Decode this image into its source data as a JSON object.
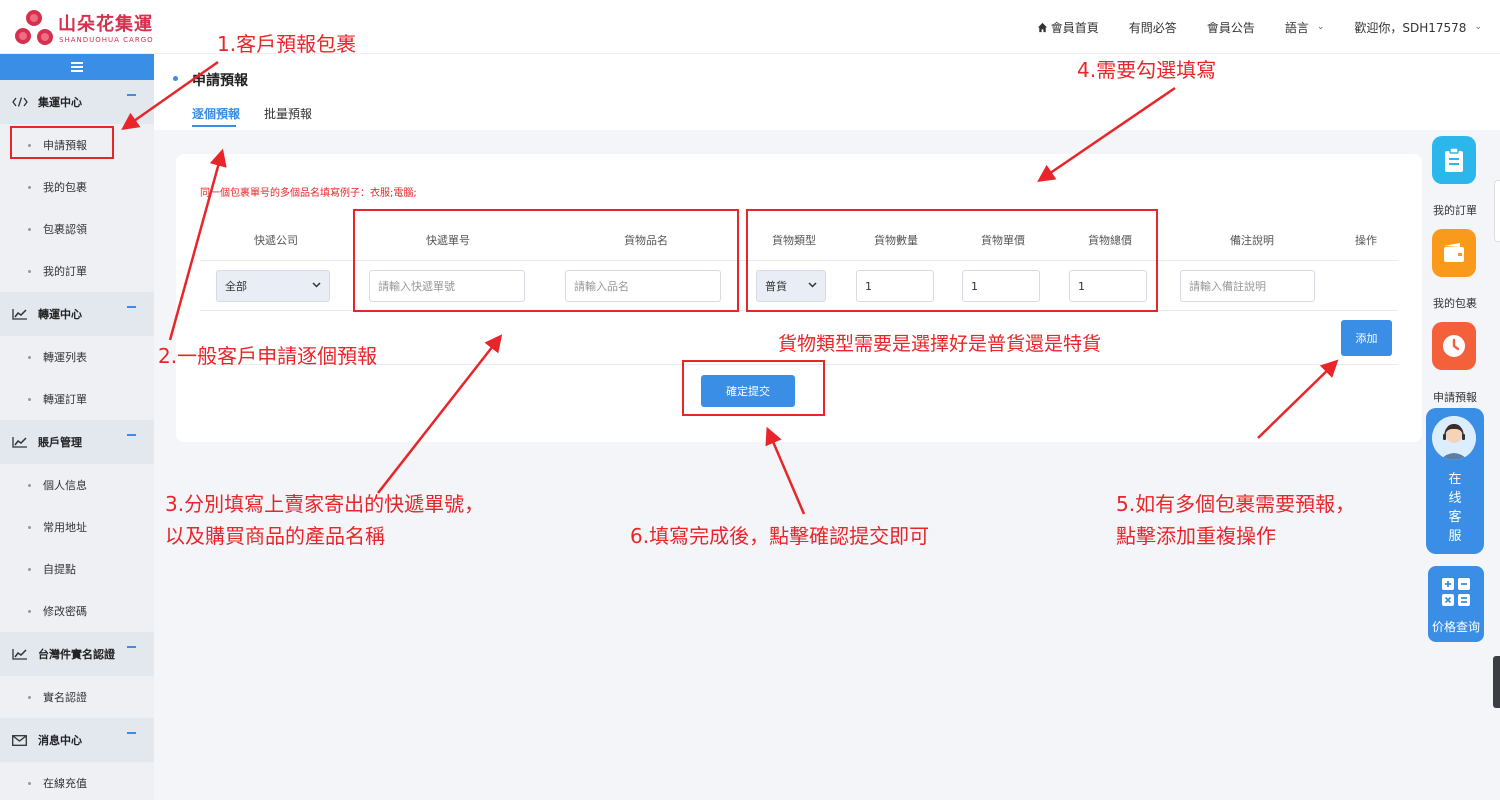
{
  "brand": {
    "name_cn": "山朵花集運",
    "name_en": "SHANDUOHUA CARGO",
    "color": "#d5314f"
  },
  "topnav": {
    "items": [
      "會員首頁",
      "有問必答",
      "會員公告",
      "語言"
    ],
    "greeting": "歡迎你，SDH17578"
  },
  "sidebar": {
    "sections": [
      {
        "title": "集運中心",
        "icon": "code-icon",
        "items": [
          "申請預報",
          "我的包裹",
          "包裹認領",
          "我的訂單"
        ]
      },
      {
        "title": "轉運中心",
        "icon": "chart-line-icon",
        "items": [
          "轉運列表",
          "轉運訂單"
        ]
      },
      {
        "title": "賬戶管理",
        "icon": "chart-line-icon",
        "items": [
          "個人信息",
          "常用地址",
          "自提點",
          "修改密碼"
        ]
      },
      {
        "title": "台灣件實名認證",
        "icon": "chart-line-icon",
        "items": [
          "實名認證"
        ]
      },
      {
        "title": "消息中心",
        "icon": "mail-icon",
        "items": [
          "在線充值"
        ]
      }
    ]
  },
  "page": {
    "title": "申請預報",
    "tabs": [
      "逐個預報",
      "批量預報"
    ]
  },
  "form": {
    "hint": "同一個包裹單号的多個品名填寫例子：衣服;電腦;",
    "headers": {
      "courier": "快遞公司",
      "tracking": "快遞單号",
      "product": "貨物品名",
      "type": "貨物類型",
      "qty": "貨物數量",
      "unit_price": "貨物單價",
      "total_price": "貨物總價",
      "note": "備注說明",
      "action": "操作"
    },
    "courier_value": "全部",
    "tracking_placeholder": "請輸入快遞單號",
    "product_placeholder": "請輸入品名",
    "type_value": "普貨",
    "qty_value": "1",
    "unit_price_value": "1",
    "total_price_value": "1",
    "note_placeholder": "請輸入備註說明",
    "add_label": "添加",
    "submit_label": "確定提交"
  },
  "float_toolbar": {
    "items": [
      "我的訂單",
      "我的包裹",
      "申請預報"
    ],
    "service_label": [
      "在",
      "线",
      "客",
      "服"
    ],
    "price_label": "价格查询"
  },
  "annotations": {
    "a1": "1.客戶預報包裹",
    "a2": "2.一般客戶申請逐個預報",
    "a3_line1": "3.分別填寫上賣家寄出的快遞單號，",
    "a3_line2": "以及購買商品的產品名稱",
    "a4": "4.需要勾選填寫",
    "a4_note": "貨物類型需要是選擇好是普貨還是特貨",
    "a5_line1": "5.如有多個包裹需要預報，",
    "a5_line2": "點擊添加重複操作",
    "a6": "6.填寫完成後，點擊確認提交即可"
  },
  "colors": {
    "primary": "#3a8ee6",
    "annotation": "#e8262a",
    "orange": "#f99a1c",
    "cyan": "#2bb7ec",
    "red_orange": "#f4603a"
  }
}
